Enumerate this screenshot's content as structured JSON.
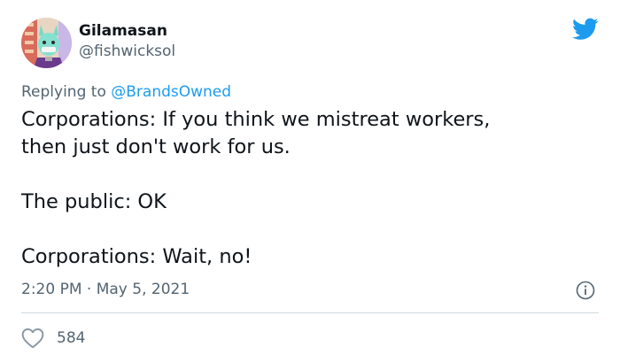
{
  "author": {
    "display_name": "Gilamasan",
    "handle": "@fishwicksol"
  },
  "reply": {
    "prefix": "Replying to ",
    "mention": "@BrandsOwned"
  },
  "tweet": {
    "line1": "Corporations: If you think we mistreat workers,",
    "line2": "then just don't work for us.",
    "line3": "The public: OK",
    "line4": "Corporations: Wait, no!"
  },
  "timestamp": "2:20 PM · May 5, 2021",
  "likes": {
    "count": "584"
  },
  "icons": {
    "brand": "twitter-bird-icon",
    "info": "info-icon",
    "like": "heart-icon"
  },
  "colors": {
    "brand_blue": "#1d9bf0",
    "secondary_text": "#536471",
    "divider": "#cfd9de",
    "like_icon": "#8b98a5"
  }
}
